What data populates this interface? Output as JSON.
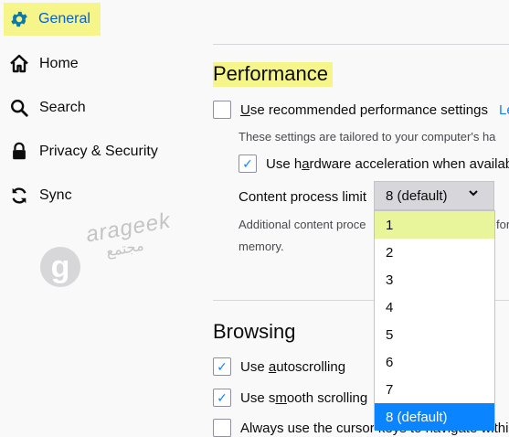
{
  "sidebar": {
    "items": [
      {
        "label": "General",
        "icon": "gear-icon"
      },
      {
        "label": "Home",
        "icon": "home-icon"
      },
      {
        "label": "Search",
        "icon": "search-icon"
      },
      {
        "label": "Privacy & Security",
        "icon": "lock-icon"
      },
      {
        "label": "Sync",
        "icon": "sync-icon"
      }
    ]
  },
  "watermark": {
    "text": "arageek",
    "sub": "مجتمع",
    "letter": "g"
  },
  "performance": {
    "title": "Performance",
    "recommended_label_u": "U",
    "recommended_label_rest": "se recommended performance settings",
    "learn_more": "Le",
    "tailored_note": "These settings are tailored to your computer's ha",
    "hw_label_pre": "Use h",
    "hw_label_u": "a",
    "hw_label_rest": "rdware acceleration when availabl",
    "limit_label": "Content process limit",
    "limit_value": "8 (default)",
    "additional_note_a": "Additional content proce",
    "additional_note_b": "for",
    "additional_note_c": "memory.",
    "options": [
      "1",
      "2",
      "3",
      "4",
      "5",
      "6",
      "7",
      "8 (default)"
    ]
  },
  "browsing": {
    "title": "Browsing",
    "autoscroll_pre": "Use ",
    "autoscroll_u": "a",
    "autoscroll_rest": "utoscrolling",
    "smooth_pre": "Use s",
    "smooth_u": "m",
    "smooth_rest": "ooth scrolling",
    "cursor_label": "Always use the cursor keys to navigate within"
  },
  "colors": {
    "accent": "#0a84ff",
    "highlight": "#f5f58a"
  }
}
